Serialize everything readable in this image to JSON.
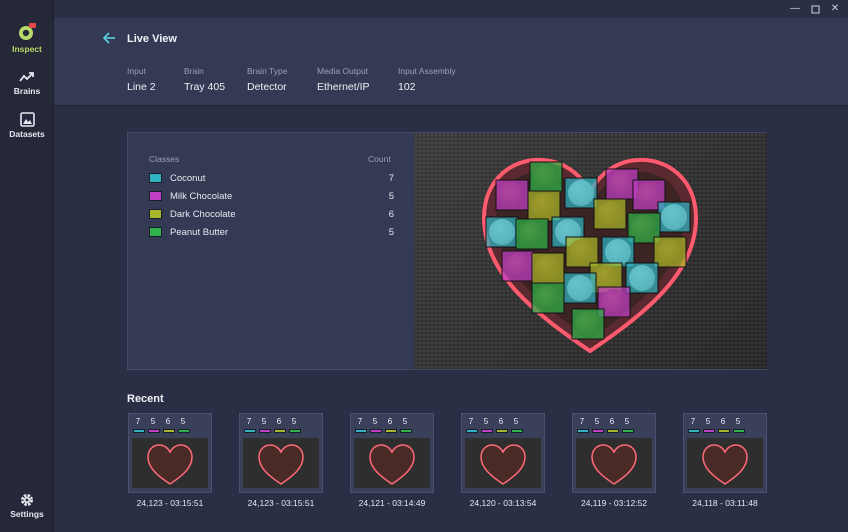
{
  "nav": {
    "inspect": "Inspect",
    "brains": "Brains",
    "datasets": "Datasets",
    "settings": "Settings"
  },
  "header": {
    "title": "Live View",
    "meta": [
      {
        "label": "Input",
        "value": "Line 2"
      },
      {
        "label": "Brain",
        "value": "Tray 405"
      },
      {
        "label": "Brain Type",
        "value": "Detector"
      },
      {
        "label": "Media Output",
        "value": "Ethernet/IP"
      },
      {
        "label": "Input Assembly",
        "value": "102"
      }
    ]
  },
  "classes": {
    "header_classes": "Classes",
    "header_count": "Count",
    "items": [
      {
        "name": "Coconut",
        "count": "7",
        "color": "#2fb3c2"
      },
      {
        "name": "Milk Chocolate",
        "count": "5",
        "color": "#c13fc6"
      },
      {
        "name": "Dark Chocolate",
        "count": "6",
        "color": "#a9b52a"
      },
      {
        "name": "Peanut Butter",
        "count": "5",
        "color": "#2fb24a"
      }
    ]
  },
  "recent": {
    "title": "Recent",
    "items": [
      {
        "counts": [
          "7",
          "5",
          "6",
          "5"
        ],
        "caption": "24,123 - 03:15:51"
      },
      {
        "counts": [
          "7",
          "5",
          "6",
          "5"
        ],
        "caption": "24,123 - 03:15:51"
      },
      {
        "counts": [
          "7",
          "5",
          "6",
          "5"
        ],
        "caption": "24,121 - 03:14:49"
      },
      {
        "counts": [
          "7",
          "5",
          "6",
          "5"
        ],
        "caption": "24,120 - 03:13:54"
      },
      {
        "counts": [
          "7",
          "5",
          "6",
          "5"
        ],
        "caption": "24,119 - 03:12:52"
      },
      {
        "counts": [
          "7",
          "5",
          "6",
          "5"
        ],
        "caption": "24,118 - 03:11:48"
      }
    ]
  }
}
